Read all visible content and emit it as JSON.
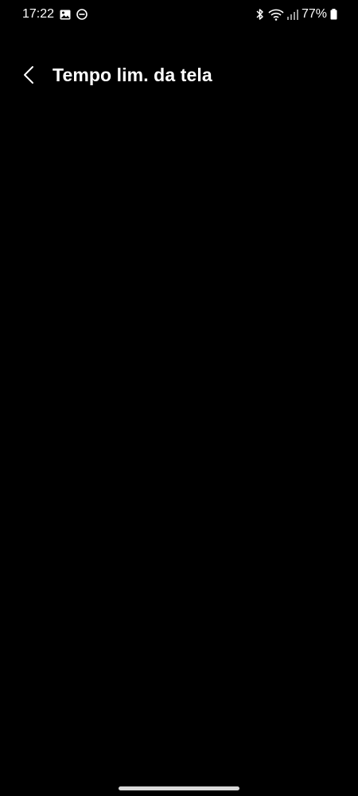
{
  "status_bar": {
    "time": "17:22",
    "battery_percent": "77%",
    "left_icons": [
      "gallery-icon",
      "do-not-disturb-icon"
    ],
    "right_icons": [
      "bluetooth-icon",
      "wifi-icon",
      "signal-icon",
      "battery-icon"
    ]
  },
  "header": {
    "title": "Tempo lim. da tela"
  },
  "colors": {
    "background": "#000000",
    "text": "#ffffff",
    "nav_handle": "#d8d8d8"
  }
}
